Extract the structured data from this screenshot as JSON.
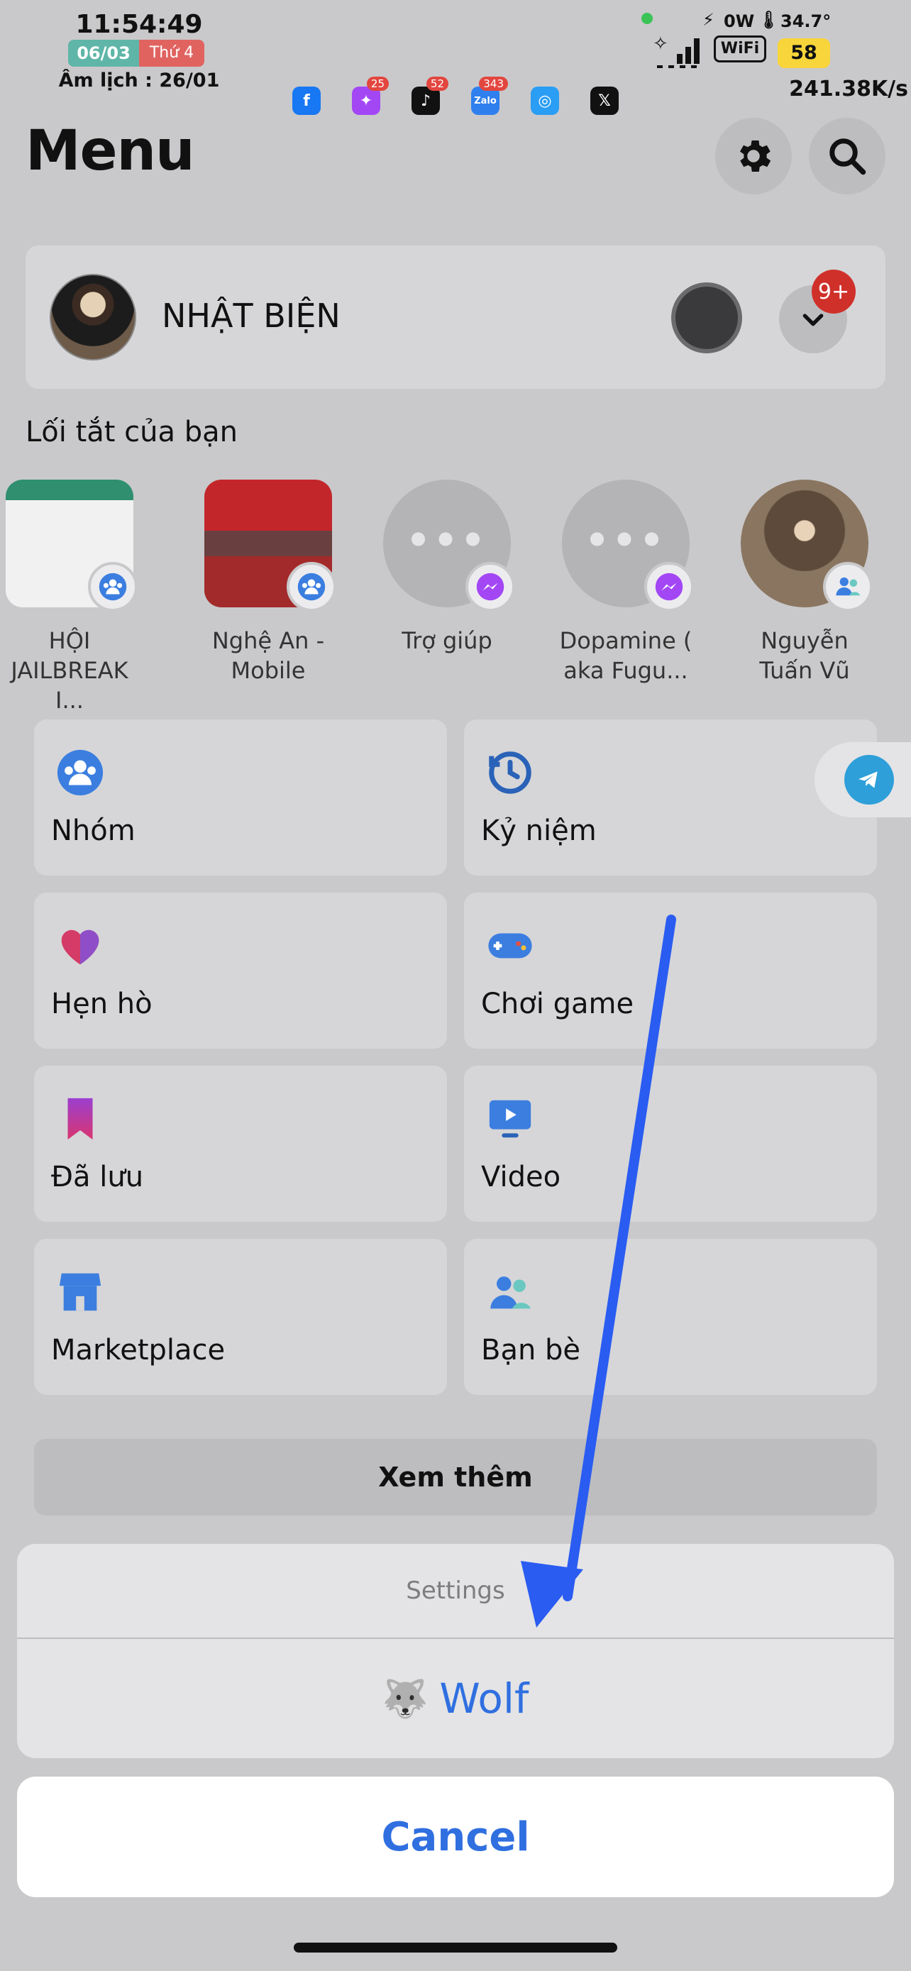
{
  "status_bar": {
    "time": "11:54:49",
    "date": "06/03",
    "weekday": "Thứ 4",
    "lunar": "Âm lịch : 26/01",
    "power": "0W",
    "temperature": "34.7°",
    "wifi": "WiFi",
    "battery": "58",
    "net_speed": "241.38K/s",
    "notification_icons": [
      {
        "name": "facebook-icon",
        "color": "#1877f2",
        "glyph": "f",
        "badge": ""
      },
      {
        "name": "messenger-icon",
        "color": "#a347f5",
        "glyph": "✦",
        "badge": "25"
      },
      {
        "name": "tiktok-icon",
        "color": "#111111",
        "glyph": "♪",
        "badge": "52"
      },
      {
        "name": "zalo-icon",
        "color": "#2f7fef",
        "glyph": "Zalo",
        "badge": "343"
      },
      {
        "name": "safari-icon",
        "color": "#2a9df4",
        "glyph": "◎",
        "badge": ""
      },
      {
        "name": "x-icon",
        "color": "#111111",
        "glyph": "𝕏",
        "badge": ""
      }
    ]
  },
  "header": {
    "title": "Menu",
    "settings_icon": "gear-icon",
    "search_icon": "search-icon"
  },
  "profile": {
    "name": "NHẬT BIỆN",
    "notification_badge": "9+"
  },
  "shortcuts": {
    "title": "Lối tắt của bạn",
    "items": [
      {
        "label": "HỘI JAILBREAK I...",
        "type": "group"
      },
      {
        "label": "Nghệ An - Mobile",
        "type": "group"
      },
      {
        "label": "Trợ giúp",
        "type": "messenger"
      },
      {
        "label": "Dopamine ( aka Fugu...",
        "type": "messenger"
      },
      {
        "label": "Nguyễn Tuấn Vũ",
        "type": "friend"
      }
    ]
  },
  "tiles": [
    {
      "label": "Nhóm",
      "icon": "groups-icon"
    },
    {
      "label": "Kỷ niệm",
      "icon": "memories-icon"
    },
    {
      "label": "Hẹn hò",
      "icon": "dating-icon"
    },
    {
      "label": "Chơi game",
      "icon": "gaming-icon"
    },
    {
      "label": "Đã lưu",
      "icon": "saved-icon"
    },
    {
      "label": "Video",
      "icon": "video-icon"
    },
    {
      "label": "Marketplace",
      "icon": "marketplace-icon"
    },
    {
      "label": "Bạn bè",
      "icon": "friends-icon"
    }
  ],
  "see_more": "Xem thêm",
  "action_sheet": {
    "title": "Settings",
    "action_emoji": "🐺",
    "action_label": "Wolf",
    "cancel": "Cancel"
  },
  "colors": {
    "accent_blue": "#2f6fe0",
    "arrow_blue": "#2a5cf2",
    "badge_red": "#d0302a",
    "telegram": "#2e9fd9"
  }
}
